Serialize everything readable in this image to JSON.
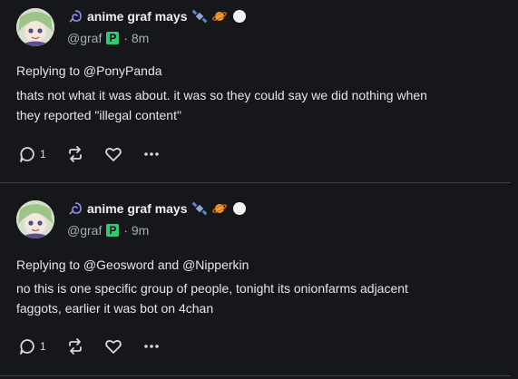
{
  "posts": [
    {
      "display_name": "anime graf mays",
      "handle": "@graf",
      "badge_letter": "P",
      "time": "· 8m",
      "replying_to": "Replying to @PonyPanda",
      "text_lines": [
        "thats not what it was about. it was so they could say we did nothing when",
        "they reported \"illegal content\""
      ],
      "reply_count": "1"
    },
    {
      "display_name": "anime graf mays",
      "handle": "@graf",
      "badge_letter": "P",
      "time": "· 9m",
      "replying_to": "Replying to @Geosword and @Nipperkin",
      "text_lines": [
        "no this is one specific group of people, tonight its onionfarms adjacent",
        "faggots, earlier it was bot on 4chan"
      ],
      "reply_count": "1"
    }
  ],
  "colors": {
    "background": "#15171b",
    "badge": "#2ecc71",
    "divider": "#3b3f46"
  }
}
